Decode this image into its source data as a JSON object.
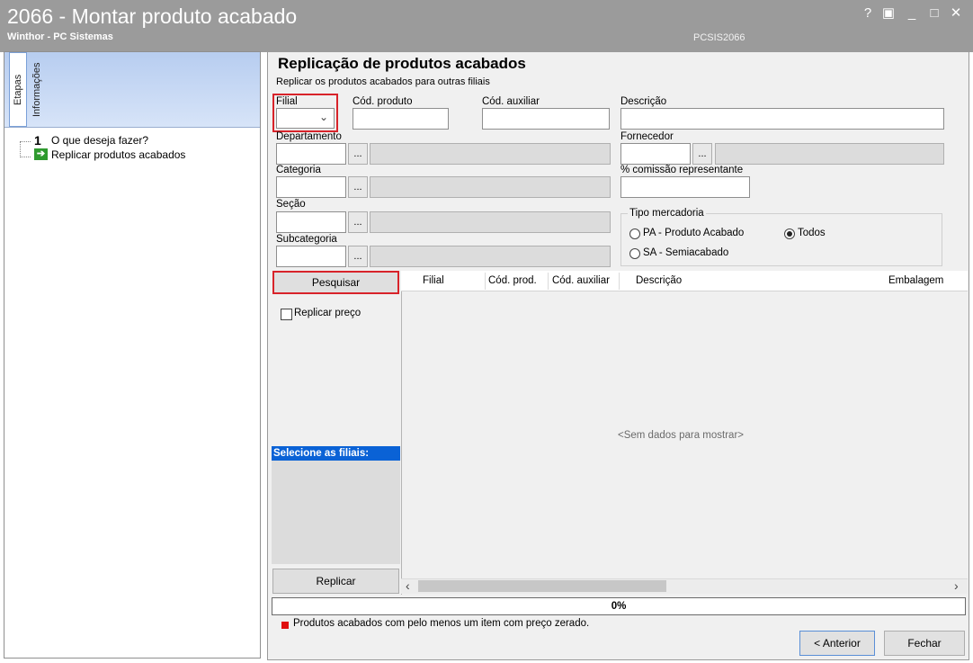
{
  "window": {
    "title": "2066 - Montar produto acabado",
    "subtitle": "Winthor - PC Sistemas",
    "code": "PCSIS2066",
    "buttons": {
      "help": "?",
      "restore": "▣",
      "minimize": "_",
      "maximize": "□",
      "close": "✕"
    }
  },
  "left_panel": {
    "tabs": [
      "Etapas",
      "Informações"
    ],
    "steps": [
      {
        "number": "1",
        "label": "O que deseja fazer?"
      },
      {
        "label": "Replicar produtos acabados"
      }
    ]
  },
  "main": {
    "title": "Replicação de produtos acabados",
    "subtitle": "Replicar os produtos acabados para outras filiais"
  },
  "form": {
    "filial": {
      "label": "Filial",
      "value": ""
    },
    "cod_produto": {
      "label": "Cód. produto",
      "value": ""
    },
    "cod_auxiliar": {
      "label": "Cód. auxiliar",
      "value": ""
    },
    "descricao": {
      "label": "Descrição",
      "value": ""
    },
    "departamento": {
      "label": "Departamento",
      "value": ""
    },
    "fornecedor": {
      "label": "Fornecedor",
      "value": ""
    },
    "categoria": {
      "label": "Categoria",
      "value": ""
    },
    "comissao": {
      "label": "% comissão representante",
      "value": ""
    },
    "secao": {
      "label": "Seção",
      "value": ""
    },
    "subcategoria": {
      "label": "Subcategoria",
      "value": ""
    },
    "ellipsis": "...",
    "tipo_mercadoria": {
      "label": "Tipo mercadoria",
      "options": [
        {
          "label": "PA - Produto Acabado",
          "selected": false
        },
        {
          "label": "Todos",
          "selected": true
        },
        {
          "label": "SA - Semiacabado",
          "selected": false
        }
      ]
    }
  },
  "actions": {
    "pesquisar": "Pesquisar",
    "replicar_preco": "Replicar preço",
    "replicar_preco_checked": false,
    "selecione_filiais": "Selecione as filiais:",
    "replicar": "Replicar"
  },
  "grid": {
    "columns": [
      "Filial",
      "Cód. prod.",
      "Cód. auxiliar",
      "Descrição",
      "Embalagem"
    ],
    "empty_message": "<Sem dados para mostrar>",
    "scroll_left": "‹",
    "scroll_right": "›"
  },
  "progress": {
    "text": "0%",
    "value": 0
  },
  "legend": {
    "text": "Produtos acabados com pelo menos um item com preço zerado.",
    "color": "#e01010"
  },
  "footer": {
    "anterior": "< Anterior",
    "fechar": "Fechar"
  },
  "colors": {
    "titlebar": "#9b9b9b",
    "highlight": "#d8232a",
    "selection": "#0a62d6"
  }
}
